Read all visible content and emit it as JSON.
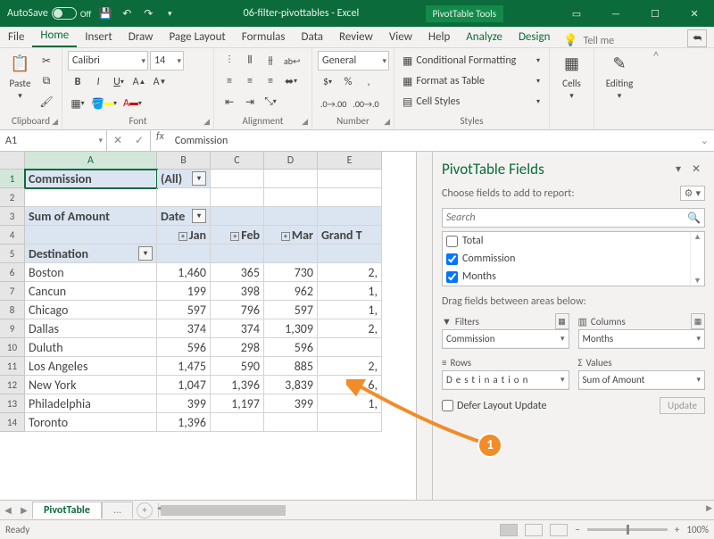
{
  "titlebar": {
    "autosave": "AutoSave",
    "autosave_off": "Off",
    "title": "06-filter-pivottables  -  Excel",
    "context_section": "PivotTable Tools"
  },
  "tabs": {
    "file": "File",
    "home": "Home",
    "insert": "Insert",
    "draw": "Draw",
    "page_layout": "Page Layout",
    "formulas": "Formulas",
    "data": "Data",
    "review": "Review",
    "view": "View",
    "help": "Help",
    "analyze": "Analyze",
    "design": "Design",
    "tell_me": "Tell me"
  },
  "ribbon": {
    "clipboard": {
      "paste": "Paste",
      "label": "Clipboard"
    },
    "font": {
      "name": "Calibri",
      "size": "14",
      "label": "Font"
    },
    "alignment": {
      "label": "Alignment"
    },
    "number": {
      "format": "General",
      "label": "Number"
    },
    "styles": {
      "conditional": "Conditional Formatting",
      "format_table": "Format as Table",
      "cell_styles": "Cell Styles",
      "label": "Styles"
    },
    "cells": {
      "label": "Cells"
    },
    "editing": {
      "label": "Editing"
    }
  },
  "name_box": "A1",
  "formula": "Commission",
  "columns": [
    "A",
    "B",
    "C",
    "D",
    "E"
  ],
  "pivot": {
    "filter_field": "Commission",
    "filter_value": "(All)",
    "values_label": "Sum of Amount",
    "col_label": "Date",
    "row_label": "Destination",
    "grand_total": "Grand Total",
    "months": [
      "Jan",
      "Feb",
      "Mar"
    ],
    "rows": [
      {
        "name": "Boston",
        "vals": [
          "1,460",
          "365",
          "730"
        ],
        "gt": "2,"
      },
      {
        "name": "Cancun",
        "vals": [
          "199",
          "398",
          "962"
        ],
        "gt": "1,"
      },
      {
        "name": "Chicago",
        "vals": [
          "597",
          "796",
          "597"
        ],
        "gt": "1,"
      },
      {
        "name": "Dallas",
        "vals": [
          "374",
          "374",
          "1,309"
        ],
        "gt": "2,"
      },
      {
        "name": "Duluth",
        "vals": [
          "596",
          "298",
          "596"
        ],
        "gt": ""
      },
      {
        "name": "Los Angeles",
        "vals": [
          "1,475",
          "590",
          "885"
        ],
        "gt": "2,"
      },
      {
        "name": "New York",
        "vals": [
          "1,047",
          "1,396",
          "3,839"
        ],
        "gt": "6,"
      },
      {
        "name": "Philadelphia",
        "vals": [
          "399",
          "1,197",
          "399"
        ],
        "gt": "1,"
      },
      {
        "name": "Toronto",
        "vals": [
          "1,396",
          "",
          ""
        ],
        "gt": ""
      }
    ]
  },
  "pane": {
    "title": "PivotTable Fields",
    "subtitle": "Choose fields to add to report:",
    "search_placeholder": "Search",
    "fields": [
      {
        "label": "Total",
        "checked": false
      },
      {
        "label": "Commission",
        "checked": true
      },
      {
        "label": "Months",
        "checked": true
      }
    ],
    "areas_label": "Drag fields between areas below:",
    "filters_label": "Filters",
    "columns_label": "Columns",
    "rows_label": "Rows",
    "values_label": "Values",
    "filters_item": "Commission",
    "columns_item": "Months",
    "rows_item": "Destination",
    "values_item": "Sum of Amount",
    "defer": "Defer Layout Update",
    "update": "Update"
  },
  "sheet_tabs": {
    "active": "PivotTable",
    "other": "..."
  },
  "statusbar": {
    "ready": "Ready",
    "zoom": "100%"
  },
  "annotation": "1"
}
